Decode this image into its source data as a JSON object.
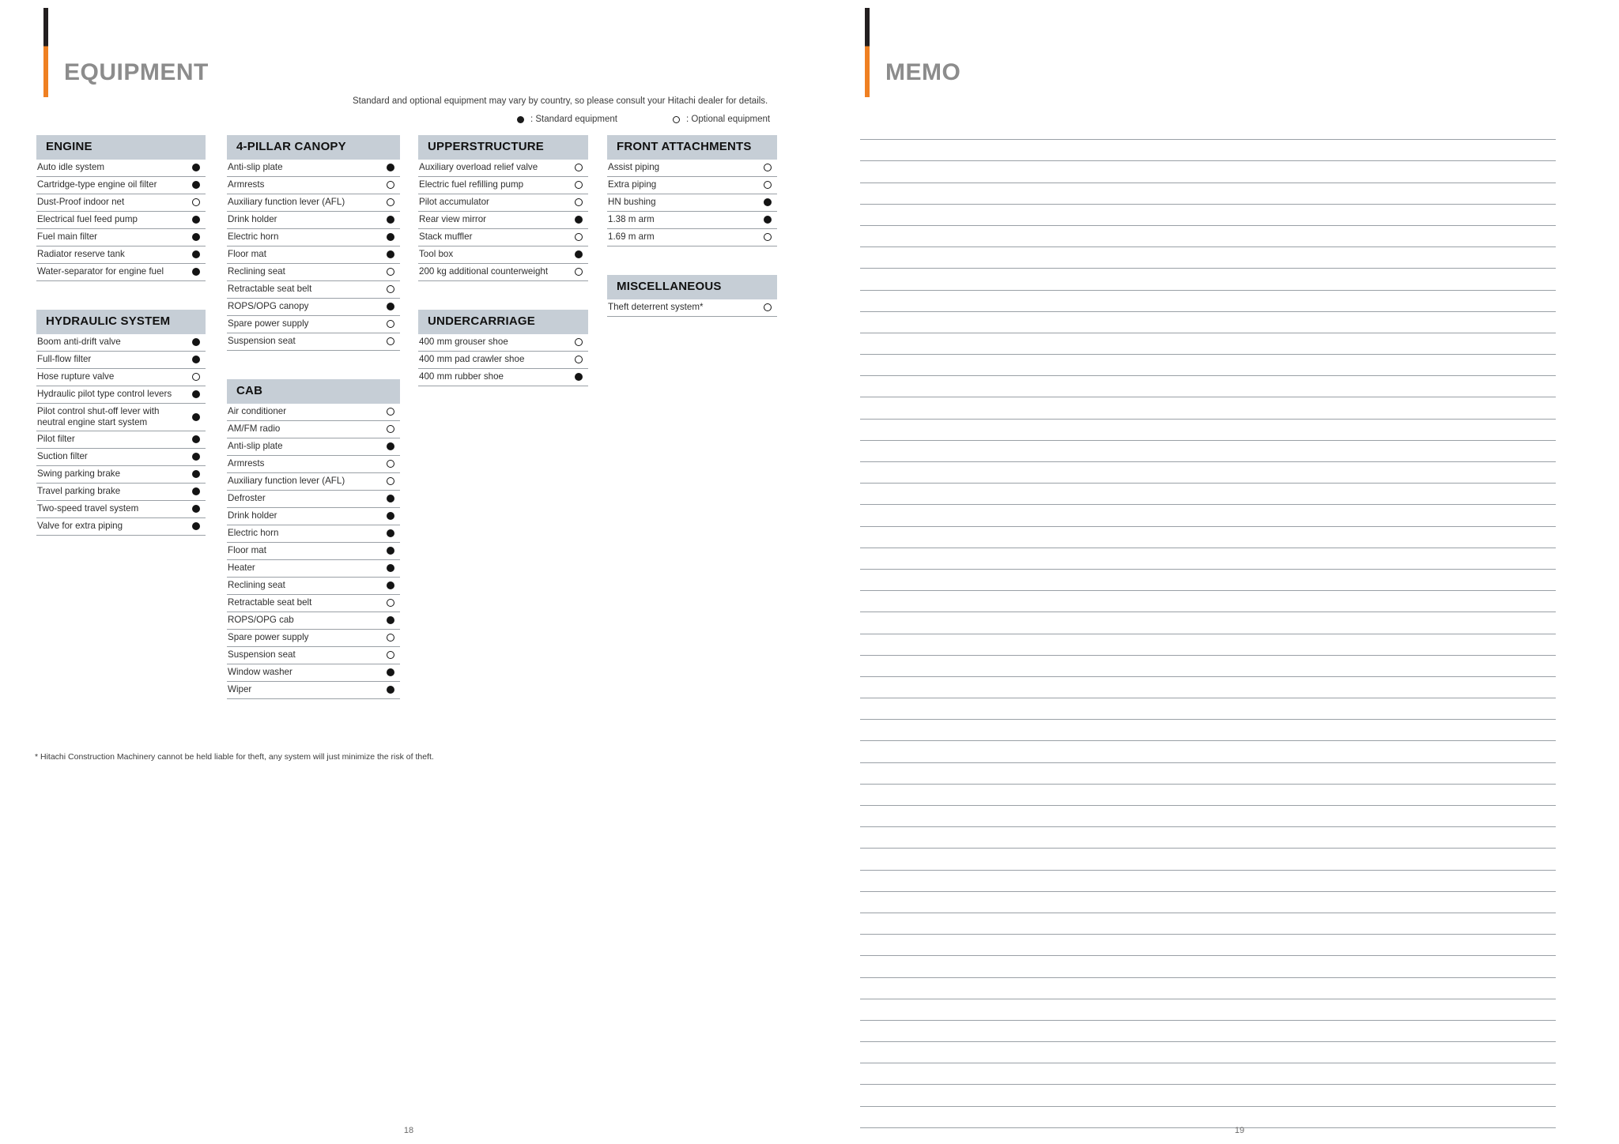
{
  "left_page": {
    "title": "EQUIPMENT",
    "folio": "18",
    "note": "Standard and optional equipment may vary by country, so please consult your Hitachi dealer for details.",
    "legend": {
      "standard_symbol": "filled-circle-icon",
      "standard_label": ": Standard equipment",
      "optional_symbol": "open-circle-icon",
      "optional_label": ": Optional equipment"
    },
    "footnote": "* Hitachi Construction Machinery cannot be held liable for theft, any system will just minimize the risk of theft.",
    "sections": [
      {
        "heading": "ENGINE",
        "rows": [
          {
            "label": "Auto idle system",
            "mark": "std"
          },
          {
            "label": "Cartridge-type engine oil filter",
            "mark": "std"
          },
          {
            "label": "Dust-Proof indoor net",
            "mark": "opt"
          },
          {
            "label": "Electrical fuel feed pump",
            "mark": "std"
          },
          {
            "label": "Fuel main filter",
            "mark": "std"
          },
          {
            "label": "Radiator reserve tank",
            "mark": "std"
          },
          {
            "label": "Water-separator for engine fuel",
            "mark": "std"
          }
        ]
      },
      {
        "heading": "HYDRAULIC SYSTEM",
        "rows": [
          {
            "label": "Boom anti-drift valve",
            "mark": "std"
          },
          {
            "label": "Full-flow filter",
            "mark": "std"
          },
          {
            "label": "Hose rupture valve",
            "mark": "opt"
          },
          {
            "label": "Hydraulic pilot type control levers",
            "mark": "std"
          },
          {
            "label": "Pilot control shut-off lever with neutral engine start system",
            "mark": "std"
          },
          {
            "label": "Pilot filter",
            "mark": "std"
          },
          {
            "label": "Suction filter",
            "mark": "std"
          },
          {
            "label": "Swing parking brake",
            "mark": "std"
          },
          {
            "label": "Travel parking brake",
            "mark": "std"
          },
          {
            "label": "Two-speed travel system",
            "mark": "std"
          },
          {
            "label": "Valve for extra piping",
            "mark": "std"
          }
        ]
      },
      {
        "heading": "4-PILLAR CANOPY",
        "rows": [
          {
            "label": "Anti-slip plate",
            "mark": "std"
          },
          {
            "label": "Armrests",
            "mark": "opt"
          },
          {
            "label": "Auxiliary function lever (AFL)",
            "mark": "opt"
          },
          {
            "label": "Drink holder",
            "mark": "std"
          },
          {
            "label": "Electric horn",
            "mark": "std"
          },
          {
            "label": "Floor mat",
            "mark": "std"
          },
          {
            "label": "Reclining seat",
            "mark": "opt"
          },
          {
            "label": "Retractable seat belt",
            "mark": "opt"
          },
          {
            "label": "ROPS/OPG canopy",
            "mark": "std"
          },
          {
            "label": "Spare power supply",
            "mark": "opt"
          },
          {
            "label": "Suspension seat",
            "mark": "opt"
          }
        ]
      },
      {
        "heading": "CAB",
        "rows": [
          {
            "label": "Air conditioner",
            "mark": "opt"
          },
          {
            "label": "AM/FM radio",
            "mark": "opt"
          },
          {
            "label": "Anti-slip plate",
            "mark": "std"
          },
          {
            "label": "Armrests",
            "mark": "opt"
          },
          {
            "label": "Auxiliary function lever (AFL)",
            "mark": "opt"
          },
          {
            "label": "Defroster",
            "mark": "std"
          },
          {
            "label": "Drink holder",
            "mark": "std"
          },
          {
            "label": "Electric horn",
            "mark": "std"
          },
          {
            "label": "Floor mat",
            "mark": "std"
          },
          {
            "label": "Heater",
            "mark": "std"
          },
          {
            "label": "Reclining seat",
            "mark": "std"
          },
          {
            "label": "Retractable seat belt",
            "mark": "opt"
          },
          {
            "label": "ROPS/OPG cab",
            "mark": "std"
          },
          {
            "label": "Spare power supply",
            "mark": "opt"
          },
          {
            "label": "Suspension seat",
            "mark": "opt"
          },
          {
            "label": "Window washer",
            "mark": "std"
          },
          {
            "label": "Wiper",
            "mark": "std"
          }
        ]
      },
      {
        "heading": "UPPERSTRUCTURE",
        "rows": [
          {
            "label": "Auxiliary overload relief valve",
            "mark": "opt"
          },
          {
            "label": "Electric fuel refilling pump",
            "mark": "opt"
          },
          {
            "label": "Pilot accumulator",
            "mark": "opt"
          },
          {
            "label": "Rear view mirror",
            "mark": "std"
          },
          {
            "label": "Stack muffler",
            "mark": "opt"
          },
          {
            "label": "Tool box",
            "mark": "std"
          },
          {
            "label": "200 kg additional counterweight",
            "mark": "opt"
          }
        ]
      },
      {
        "heading": "UNDERCARRIAGE",
        "rows": [
          {
            "label": "400 mm grouser shoe",
            "mark": "opt"
          },
          {
            "label": "400 mm pad crawler shoe",
            "mark": "opt"
          },
          {
            "label": "400 mm rubber shoe",
            "mark": "std"
          }
        ]
      },
      {
        "heading": "FRONT ATTACHMENTS",
        "rows": [
          {
            "label": "Assist piping",
            "mark": "opt"
          },
          {
            "label": "Extra piping",
            "mark": "opt"
          },
          {
            "label": "HN bushing",
            "mark": "std"
          },
          {
            "label": "1.38 m arm",
            "mark": "std"
          },
          {
            "label": "1.69 m arm",
            "mark": "opt"
          }
        ]
      },
      {
        "heading": "MISCELLANEOUS",
        "rows": [
          {
            "label": "Theft deterrent system*",
            "mark": "opt"
          }
        ]
      }
    ]
  },
  "right_page": {
    "title": "MEMO",
    "folio": "19",
    "line_count": 47
  },
  "colors": {
    "accent_orange": "#ef8022",
    "rule_dark": "#231f20",
    "heading_bg": "#c6ced6",
    "title_gray": "#8c8c8c",
    "row_rule": "#9aa0a6"
  }
}
